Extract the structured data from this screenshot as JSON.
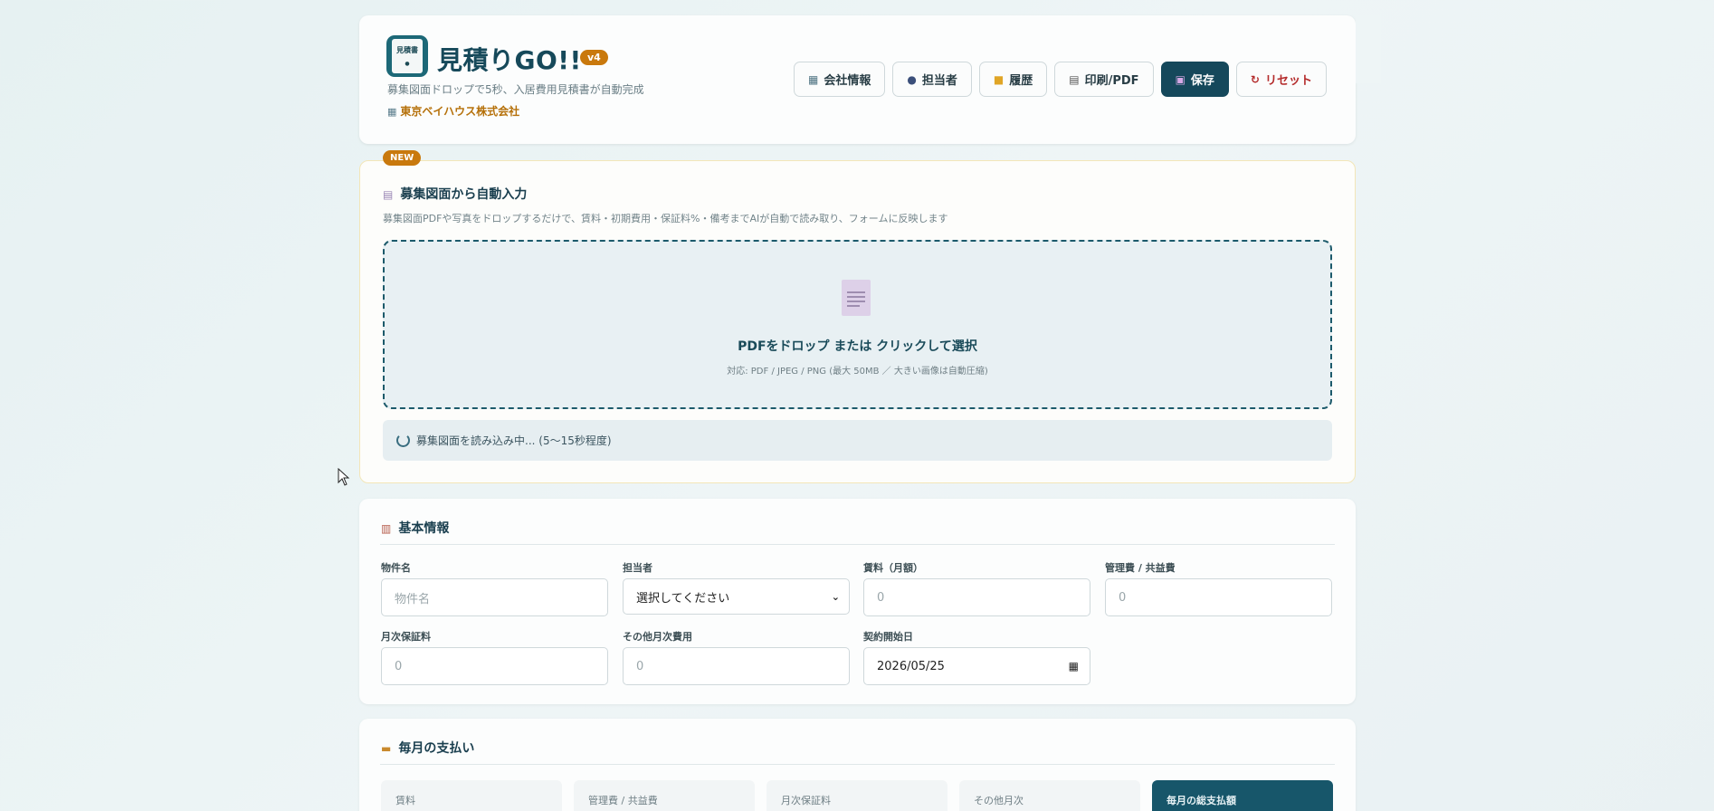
{
  "header": {
    "app_title": "見積りGO!!",
    "version": "v4",
    "logo_text": "見積書",
    "tagline": "募集図面ドロップで5秒、入居費用見積書が自動完成",
    "company": "東京ベイハウス株式会社",
    "toolbar": {
      "company_info": "会社情報",
      "staff": "担当者",
      "history": "履歴",
      "print": "印刷/PDF",
      "save": "保存",
      "reset": "リセット"
    }
  },
  "upload": {
    "badge": "NEW",
    "title": "募集図面から自動入力",
    "description": "募集図面PDFや写真をドロップするだけで、賃料・初期費用・保証料%・備考までAIが自動で読み取り、フォームに反映します",
    "drop_main": "PDFをドロップ または クリックして選択",
    "drop_sub": "対応: PDF / JPEG / PNG (最大 50MB ／ 大きい画像は自動圧縮)",
    "loading_text": "募集図面を読み込み中... (5〜15秒程度)"
  },
  "basic_info": {
    "title": "基本情報",
    "fields": {
      "property_name": {
        "label": "物件名",
        "placeholder": "物件名"
      },
      "staff": {
        "label": "担当者",
        "value": "選択してください"
      },
      "rent": {
        "label": "賃料（月額）",
        "placeholder": "0"
      },
      "management_fee": {
        "label": "管理費 / 共益費",
        "placeholder": "0"
      },
      "monthly_guarantee": {
        "label": "月次保証料",
        "placeholder": "0"
      },
      "other_monthly": {
        "label": "その他月次費用",
        "placeholder": "0"
      },
      "contract_start": {
        "label": "契約開始日",
        "value": "2026/05/25"
      }
    }
  },
  "monthly": {
    "title": "毎月の支払い",
    "cells": [
      "賃料",
      "管理費 / 共益費",
      "月次保証料",
      "その他月次",
      "毎月の総支払額"
    ]
  }
}
